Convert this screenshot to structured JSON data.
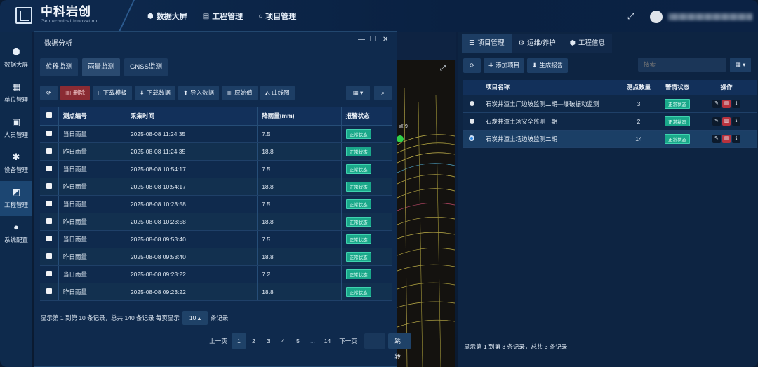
{
  "brand": {
    "name_cn": "中科岩创",
    "name_en": "Geotechnical innovation"
  },
  "topnav": [
    {
      "label": "数据大屏",
      "icon": "cube-icon"
    },
    {
      "label": "工程管理",
      "icon": "monitor-icon"
    },
    {
      "label": "项目管理",
      "icon": "circle-icon"
    }
  ],
  "sidebar": [
    {
      "label": "数据大屏",
      "icon": "cube-icon"
    },
    {
      "label": "单位管理",
      "icon": "calendar-icon"
    },
    {
      "label": "人员管理",
      "icon": "user-doc-icon"
    },
    {
      "label": "设备管理",
      "icon": "gear-icon"
    },
    {
      "label": "工程管理",
      "icon": "chart-icon"
    },
    {
      "label": "系统配置",
      "icon": "dots-icon"
    }
  ],
  "left_panel": {
    "title": "数据分析",
    "tabs": [
      "位移监测",
      "雨量监测",
      "GNSS监测"
    ],
    "active_tab": 1,
    "toolbar": {
      "delete": "删除",
      "download_template": "下载模板",
      "download_data": "下载数据",
      "import_data": "导入数据",
      "raw_value": "原始值",
      "curve_chart": "曲线图"
    },
    "columns": [
      "测点编号",
      "采集时间",
      "降雨量(mm)",
      "报警状态"
    ],
    "rows": [
      {
        "name": "当日雨量",
        "time": "2025-08-08 11:24:35",
        "value": "7.5",
        "status": "正常状态"
      },
      {
        "name": "昨日雨量",
        "time": "2025-08-08 11:24:35",
        "value": "18.8",
        "status": "正常状态"
      },
      {
        "name": "当日雨量",
        "time": "2025-08-08 10:54:17",
        "value": "7.5",
        "status": "正常状态"
      },
      {
        "name": "昨日雨量",
        "time": "2025-08-08 10:54:17",
        "value": "18.8",
        "status": "正常状态"
      },
      {
        "name": "当日雨量",
        "time": "2025-08-08 10:23:58",
        "value": "7.5",
        "status": "正常状态"
      },
      {
        "name": "昨日雨量",
        "time": "2025-08-08 10:23:58",
        "value": "18.8",
        "status": "正常状态"
      },
      {
        "name": "当日雨量",
        "time": "2025-08-08 09:53:40",
        "value": "7.5",
        "status": "正常状态"
      },
      {
        "name": "昨日雨量",
        "time": "2025-08-08 09:53:40",
        "value": "18.8",
        "status": "正常状态"
      },
      {
        "name": "当日雨量",
        "time": "2025-08-08 09:23:22",
        "value": "7.2",
        "status": "正常状态"
      },
      {
        "name": "昨日雨量",
        "time": "2025-08-08 09:23:22",
        "value": "18.8",
        "status": "正常状态"
      }
    ],
    "footer": {
      "summary": "显示第 1 到第 10 条记录，总共 140 条记录 每页显示",
      "page_size": "10",
      "suffix": "条记录"
    },
    "pager": {
      "prev": "上一页",
      "pages": [
        "1",
        "2",
        "3",
        "4",
        "5",
        "...",
        "14"
      ],
      "next": "下一页",
      "jump": "跳转"
    }
  },
  "map": {
    "label": "点 9"
  },
  "right_panel": {
    "tabs": [
      "项目管理",
      "运维/养护",
      "工程信息"
    ],
    "toolbar": {
      "add": "添加项目",
      "report": "生成报告"
    },
    "search_placeholder": "搜索",
    "columns": [
      "项目名称",
      "测点数量",
      "警情状态",
      "操作"
    ],
    "rows": [
      {
        "name": "石炭井潼土厂边坡监测二期—爆破振动监测",
        "count": "3",
        "status": "正常状态",
        "selected": false
      },
      {
        "name": "石炭井潼土场安全监测一期",
        "count": "2",
        "status": "正常状态",
        "selected": false
      },
      {
        "name": "石炭井潼土场边坡监测二期",
        "count": "14",
        "status": "正常状态",
        "selected": true
      }
    ],
    "footer": "显示第 1 到第 3 条记录，总共 3 条记录"
  }
}
